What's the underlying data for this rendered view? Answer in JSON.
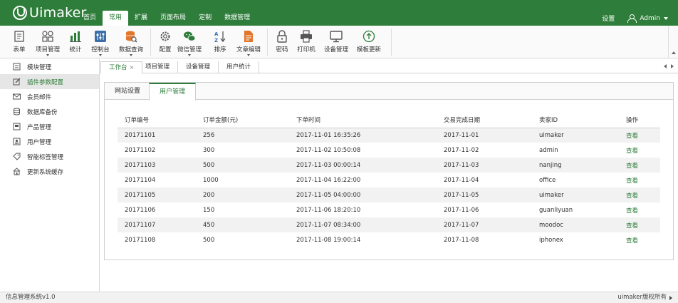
{
  "app": {
    "logo_text": "Uimaker"
  },
  "nav": {
    "items": [
      {
        "label": "首页"
      },
      {
        "label": "常用"
      },
      {
        "label": "扩展"
      },
      {
        "label": "页面布局"
      },
      {
        "label": "定制"
      },
      {
        "label": "数据管理"
      }
    ],
    "active_index": 1
  },
  "header": {
    "settings_label": "设置",
    "user_name": "Admin"
  },
  "toolbar": {
    "items": [
      {
        "label": "表单",
        "icon": "form-icon",
        "dropdown": false
      },
      {
        "label": "项目管理",
        "icon": "grid-icon",
        "dropdown": true
      },
      {
        "label": "统计",
        "icon": "bar-chart-icon",
        "dropdown": false
      },
      {
        "label": "控制台",
        "icon": "sliders-icon",
        "dropdown": true
      },
      {
        "label": "数据查询",
        "icon": "database-search-icon",
        "dropdown": true
      },
      {
        "label": "配置",
        "icon": "gear-icon",
        "dropdown": false
      },
      {
        "label": "微信管理",
        "icon": "wechat-icon",
        "dropdown": true
      },
      {
        "label": "排序",
        "icon": "sort-az-icon",
        "dropdown": false
      },
      {
        "label": "文章编辑",
        "icon": "document-edit-icon",
        "dropdown": true
      },
      {
        "label": "密码",
        "icon": "lock-icon",
        "dropdown": false
      },
      {
        "label": "打印机",
        "icon": "printer-icon",
        "dropdown": false
      },
      {
        "label": "设备管理",
        "icon": "monitor-icon",
        "dropdown": false
      },
      {
        "label": "模板更新",
        "icon": "upload-circle-icon",
        "dropdown": false
      }
    ]
  },
  "sidebar": {
    "items": [
      {
        "label": "模块管理",
        "icon": "book-icon"
      },
      {
        "label": "插件参数配置",
        "icon": "edit-icon"
      },
      {
        "label": "会员邮件",
        "icon": "mail-icon"
      },
      {
        "label": "数据库备份",
        "icon": "database-icon"
      },
      {
        "label": "产品管理",
        "icon": "folder-icon"
      },
      {
        "label": "用户管理",
        "icon": "user-card-icon"
      },
      {
        "label": "智能标签管理",
        "icon": "tag-icon"
      },
      {
        "label": "更新系统缓存",
        "icon": "home-refresh-icon"
      }
    ],
    "active_index": 1
  },
  "tabs": {
    "items": [
      {
        "label": "工作台",
        "closable": true
      },
      {
        "label": "项目管理",
        "closable": false
      },
      {
        "label": "设备管理",
        "closable": false
      },
      {
        "label": "用户统计",
        "closable": false
      }
    ],
    "active_index": 0,
    "close_glyph": "×"
  },
  "subtabs": {
    "items": [
      {
        "label": "网站设置"
      },
      {
        "label": "用户管理"
      }
    ],
    "active_index": 1
  },
  "table": {
    "columns": [
      "订单编号",
      "订单金额(元)",
      "下单时间",
      "交易完成日期",
      "卖家ID",
      "操作"
    ],
    "rows": [
      [
        "20171101",
        "256",
        "2017-11-01 16:35:26",
        "2017-11-01",
        "uimaker",
        "查看"
      ],
      [
        "20171102",
        "300",
        "2017-11-02 10:50:08",
        "2017-11-02",
        "admin",
        "查看"
      ],
      [
        "20171103",
        "500",
        "2017-11-03 00:00:14",
        "2017-11-03",
        "nanjing",
        "查看"
      ],
      [
        "20171104",
        "1000",
        "2017-11-04 16:22:00",
        "2017-11-04",
        "office",
        "查看"
      ],
      [
        "20171105",
        "200",
        "2017-11-05 04:00:00",
        "2017-11-05",
        "uimaker",
        "查看"
      ],
      [
        "20171106",
        "150",
        "2017-11-06 18:20:10",
        "2017-11-06",
        "guanliyuan",
        "查看"
      ],
      [
        "20171107",
        "450",
        "2017-11-07 08:34:00",
        "2017-11-07",
        "moodoc",
        "查看"
      ],
      [
        "20171108",
        "500",
        "2017-11-08 19:00:14",
        "2017-11-08",
        "iphonex",
        "查看"
      ]
    ]
  },
  "status": {
    "left": "信息管理系统v1.0",
    "right": "uimaker版权所有"
  },
  "colors": {
    "brand": "#2e7d3a",
    "accent_orange": "#e2762b",
    "accent_blue": "#3a6ea8"
  }
}
